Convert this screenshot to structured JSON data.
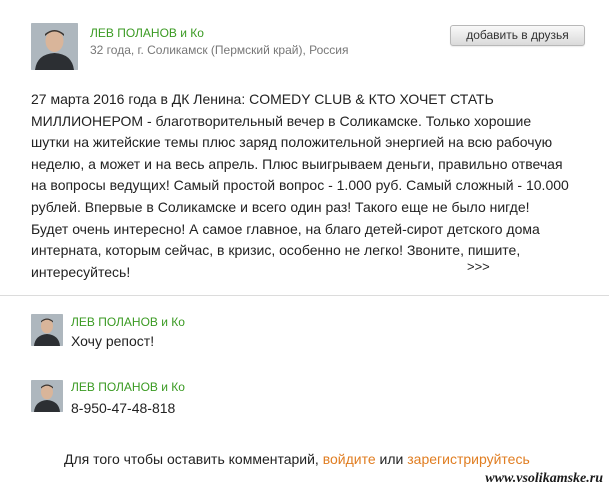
{
  "post": {
    "author_name": "ЛЕВ ПОЛАНОВ и Ко",
    "author_meta": "32 года, г. Соликамск (Пермский край), Россия",
    "add_friend_label": "добавить в друзья",
    "text_lines": [
      "27 марта 2016 года в ДК Ленина: COMEDY CLUB & КТО ХОЧЕТ СТАТЬ",
      "МИЛЛИОНЕРОМ - благотворительный вечер в Соликамске. Только хорошие",
      "шутки на житейские темы плюс заряд положительной энергией на всю рабочую",
      "неделю, а может и на весь апрель. Плюс выигрываем деньги, правильно отвечая",
      "на вопросы ведущих! Самый простой вопрос - 1.000 руб. Самый сложный - 10.000",
      "рублей. Впервые в Соликамске и всего один раз! Такого еще не было нигде!",
      "Будет очень интересно! А самое главное, на благо детей-сирот детского дома",
      "интерната, которым сейчас, в кризис, особенно не легко! Звоните, пишите,",
      "интересуйтесь!"
    ],
    "more_label": ">>>"
  },
  "comments": [
    {
      "author_name": "ЛЕВ ПОЛАНОВ и Ко",
      "text": "Хочу репост!"
    },
    {
      "author_name": "ЛЕВ ПОЛАНОВ и Ко",
      "text": "8-950-47-48-818"
    }
  ],
  "footer": {
    "prefix": "Для того чтобы оставить комментарий,",
    "login_label": "войдите",
    "middle": "или",
    "register_label": "зарегистрируйтесь"
  },
  "watermark": "www.vsolikamske.ru",
  "colors": {
    "author_link": "#3a9a22",
    "footer_link": "#e07d21",
    "divider": "#dcdcdc"
  }
}
